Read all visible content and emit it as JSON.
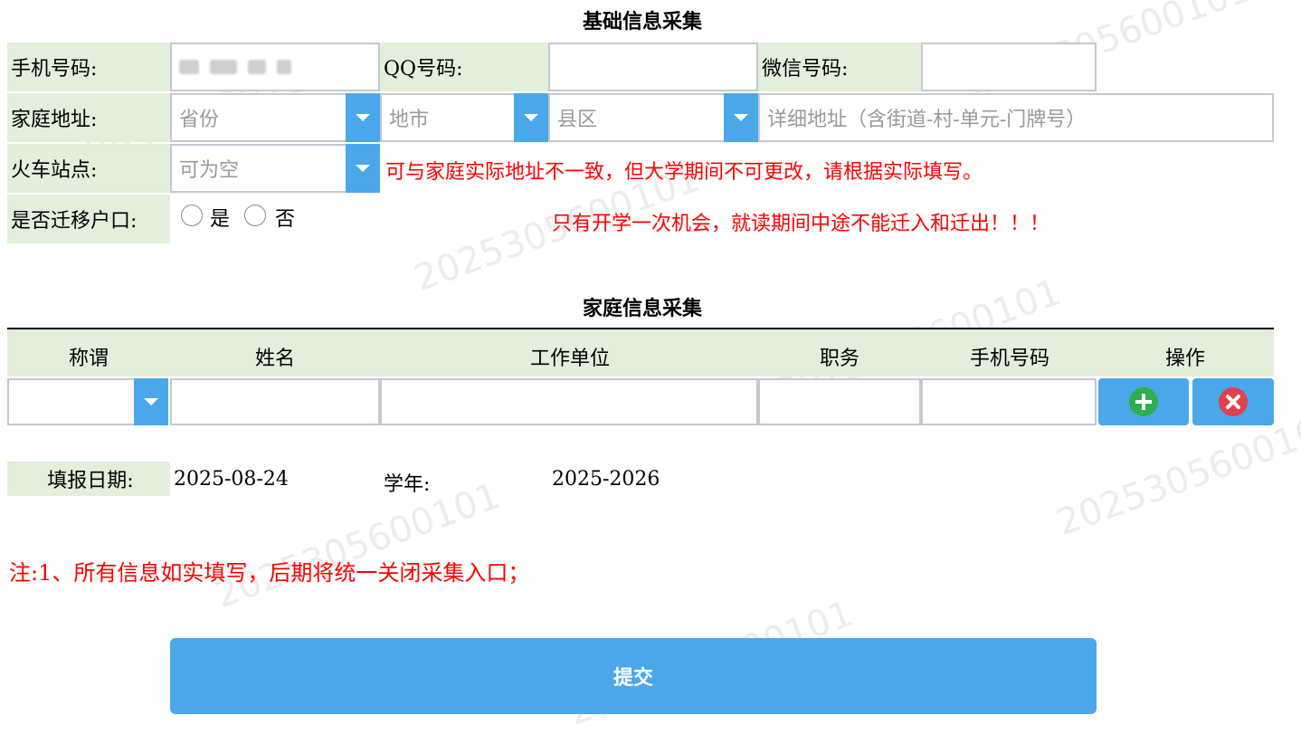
{
  "basic": {
    "title": "基础信息采集",
    "phone_label": "手机号码:",
    "qq_label": "QQ号码:",
    "wechat_label": "微信号码:",
    "address_label": "家庭地址:",
    "province_placeholder": "省份",
    "city_placeholder": "地市",
    "county_placeholder": "县区",
    "detail_placeholder": "详细地址（含街道-村-单元-门牌号）",
    "station_label": "火车站点:",
    "station_placeholder": "可为空",
    "station_note": "可与家庭实际地址不一致，但大学期间不可更改，请根据实际填写。",
    "hukou_label": "是否迁移户口:",
    "yes_label": "是",
    "no_label": "否",
    "hukou_note": "只有开学一次机会，就读期间中途不能迁入和迁出！！！"
  },
  "family": {
    "title": "家庭信息采集",
    "columns": [
      "称谓",
      "姓名",
      "工作单位",
      "职务",
      "手机号码",
      "操作"
    ]
  },
  "meta": {
    "date_label": "填报日期:",
    "date_value": "2025-08-24",
    "year_label": "学年:",
    "year_value": "2025-2026"
  },
  "note": "注:1、所有信息如实填写，后期将统一关闭采集入口；",
  "submit_label": "提交",
  "watermark": "2025305600101",
  "colors": {
    "label_bg": "#e2efda",
    "accent": "#4aa8ea",
    "warning": "#ff0000"
  }
}
